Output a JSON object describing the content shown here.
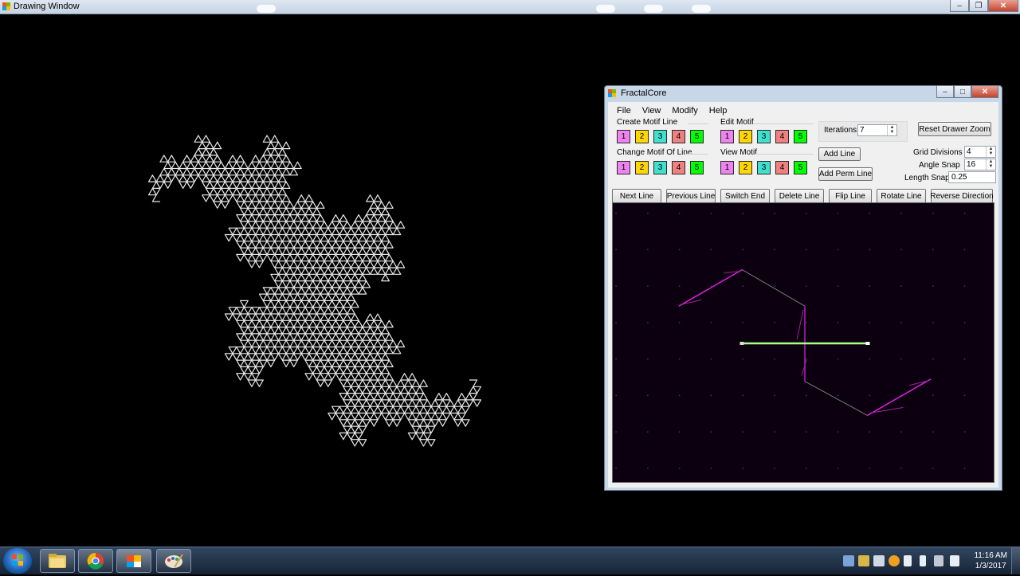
{
  "outer_window": {
    "title": "Drawing Window"
  },
  "fractal_window": {
    "title": "FractalCore",
    "menu": [
      "File",
      "View",
      "Modify",
      "Help"
    ],
    "groups": {
      "create_motif_line": "Create Motif Line",
      "edit_motif": "Edit Motif",
      "change_motif_of_line": "Change Motif Of Line",
      "view_motif": "View Motif"
    },
    "numbers": [
      "1",
      "2",
      "3",
      "4",
      "5"
    ],
    "iterations": {
      "label": "Iterations",
      "value": "7"
    },
    "buttons": {
      "add_line": "Add Line",
      "add_perm_line": "Add Perm Line",
      "reset_zoom": "Reset Drawer Zoom"
    },
    "grid_divisions": {
      "label": "Grid Divisions",
      "value": "4"
    },
    "angle_snap": {
      "label": "Angle Snap",
      "value": "16"
    },
    "length_snap": {
      "label": "Length Snap",
      "value": "0.25"
    },
    "action_buttons": [
      "Next Line",
      "Previous Line",
      "Switch End",
      "Delete Line",
      "Flip Line",
      "Rotate Line",
      "Reverse Direction"
    ]
  },
  "taskbar": {
    "apps": [
      "explorer-icon",
      "chrome-icon",
      "window-app-icon",
      "paint-app-icon"
    ],
    "time": "11:16 AM",
    "date": "1/3/2017"
  },
  "colors": {
    "motif_1": "#ee82ee",
    "motif_2": "#ffd700",
    "motif_3": "#40e0d0",
    "motif_4": "#f08080",
    "motif_5": "#00ff00",
    "editor_bg": "#0c0010"
  }
}
